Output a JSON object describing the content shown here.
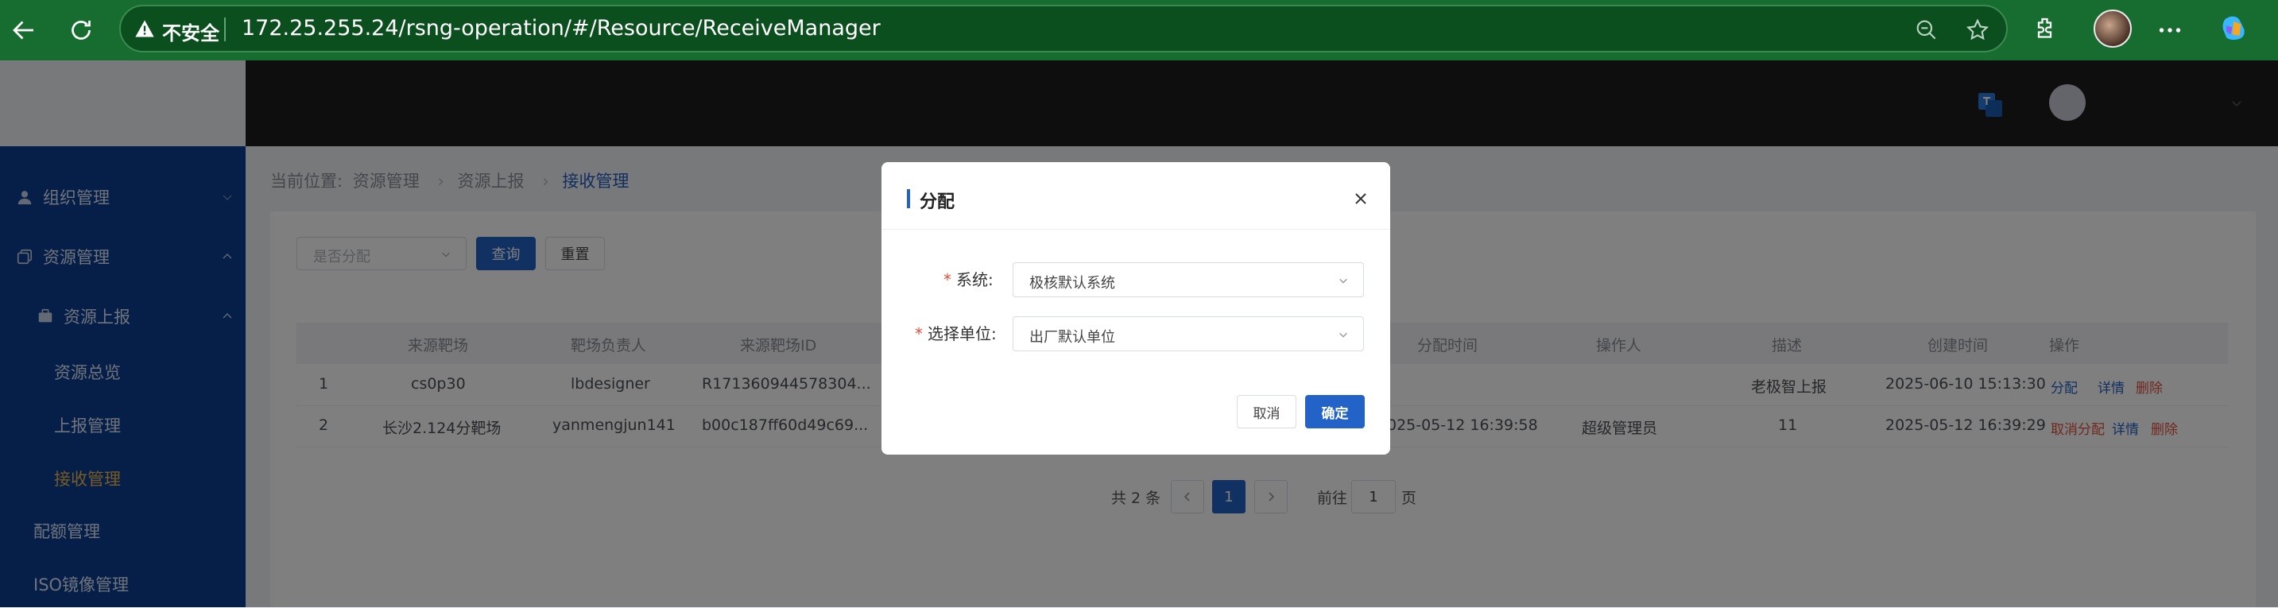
{
  "browser": {
    "security_label": "不安全",
    "url": "172.25.255.24/rsng-operation/#/Resource/ReceiveManager"
  },
  "sidebar": {
    "items": [
      {
        "label": "组织管理",
        "icon": "user-icon",
        "expanded": false
      },
      {
        "label": "资源管理",
        "icon": "copy-icon",
        "expanded": true
      },
      {
        "label": "资源上报",
        "icon": "briefcase-icon",
        "expanded": true
      },
      {
        "label": "资源总览"
      },
      {
        "label": "上报管理"
      },
      {
        "label": "接收管理",
        "active": true
      },
      {
        "label": "配额管理"
      },
      {
        "label": "ISO镜像管理"
      }
    ]
  },
  "breadcrumb": {
    "prefix": "当前位置:",
    "items": [
      "资源管理",
      "资源上报",
      "接收管理"
    ]
  },
  "filter": {
    "select_placeholder": "是否分配",
    "query_label": "查询",
    "reset_label": "重置"
  },
  "table": {
    "columns": [
      "来源靶场",
      "靶场负责人",
      "来源靶场ID",
      "分配时间",
      "操作人",
      "描述",
      "创建时间",
      "操作"
    ],
    "rows": [
      {
        "index": "1",
        "source": "cs0p30",
        "owner": "lbdesigner",
        "source_id": "R171360944578304...",
        "assign_time": "",
        "operator": "",
        "desc": "老极智上报",
        "created": "2025-06-10 15:13:30",
        "actions": [
          {
            "label": "分配",
            "color": "blue"
          },
          {
            "label": "详情",
            "color": "blue"
          },
          {
            "label": "删除",
            "color": "red"
          }
        ]
      },
      {
        "index": "2",
        "source": "长沙2.124分靶场",
        "owner": "yanmengjun141",
        "source_id": "b00c187ff60d49c69...",
        "assign_time": "025-05-12 16:39:58",
        "operator": "超级管理员",
        "desc": "11",
        "created": "2025-05-12 16:39:29",
        "actions": [
          {
            "label": "取消分配",
            "color": "red"
          },
          {
            "label": "详情",
            "color": "blue"
          },
          {
            "label": "删除",
            "color": "red"
          }
        ]
      }
    ]
  },
  "pagination": {
    "total_text": "共 2 条",
    "current_page": "1",
    "goto_label": "前往",
    "goto_value": "1",
    "page_suffix": "页"
  },
  "modal": {
    "title": "分配",
    "fields": [
      {
        "label": "系统:",
        "value": "极核默认系统",
        "required": true
      },
      {
        "label": "选择单位:",
        "value": "出厂默认单位",
        "required": true
      }
    ],
    "cancel_label": "取消",
    "confirm_label": "确定"
  },
  "colors": {
    "primary": "#2362c7",
    "sidebar": "#0d3f92",
    "browser": "#176c30",
    "danger": "#e0503f",
    "active_menu": "#f0b64a"
  }
}
